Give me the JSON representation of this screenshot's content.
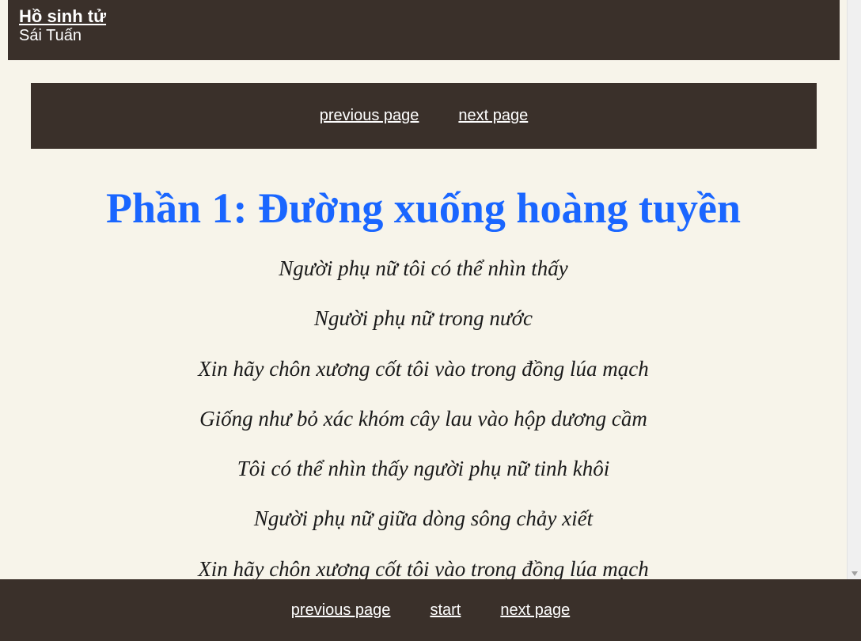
{
  "header": {
    "book_title": "Hồ sinh tử",
    "author": "Sái Tuấn"
  },
  "top_nav": {
    "previous_label": "previous page",
    "next_label": "next page"
  },
  "chapter": {
    "title": "Phần 1: Đường xuống hoàng tuyền",
    "verses": [
      "Người phụ nữ tôi có thể nhìn thấy",
      "Người phụ nữ trong nước",
      "Xin hãy chôn xương cốt tôi vào trong đồng lúa mạch",
      "Giống như bỏ xác khóm cây lau vào hộp dương cầm",
      "Tôi có thể nhìn thấy người phụ nữ tinh khôi",
      "Người phụ nữ giữa dòng sông chảy xiết",
      "Xin hãy chôn xương cốt tôi vào trong đồng lúa mạch"
    ]
  },
  "footer_nav": {
    "previous_label": "previous page",
    "start_label": "start",
    "next_label": "next page"
  },
  "colors": {
    "bar_background": "#3a302a",
    "page_background": "#f7f4ea",
    "title_blue": "#1a66ff"
  }
}
